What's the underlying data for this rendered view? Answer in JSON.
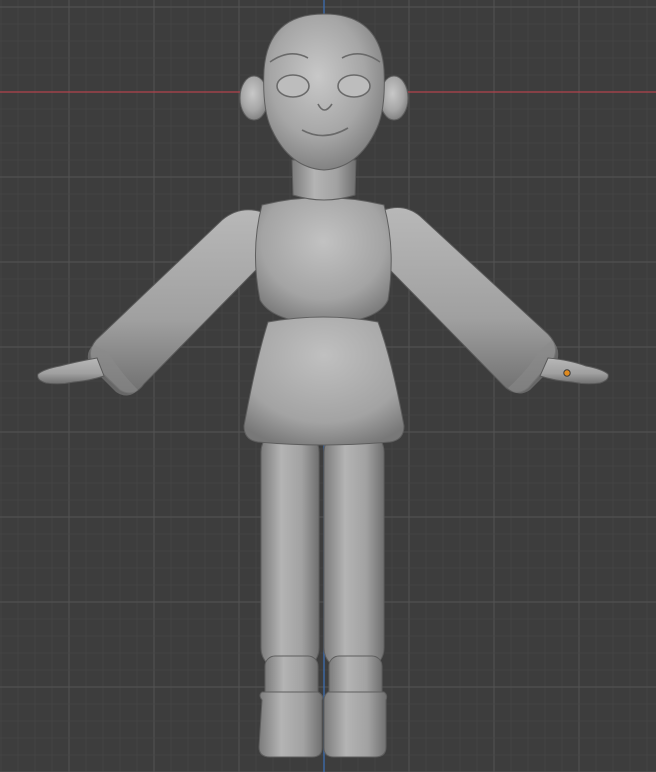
{
  "viewport": {
    "mode": "front-orthographic",
    "background_color": "#3d3d3d",
    "grid_minor_color": "#464646",
    "grid_major_color": "#515151",
    "x_axis_color": "#b0404a",
    "z_axis_color": "#3a6fb7",
    "origin_marker_color": "#e08a1e"
  },
  "model": {
    "type": "character-base-mesh",
    "pose": "a-pose",
    "material_color": "#a9a9a9",
    "icon": "sculpt-mesh-icon"
  }
}
